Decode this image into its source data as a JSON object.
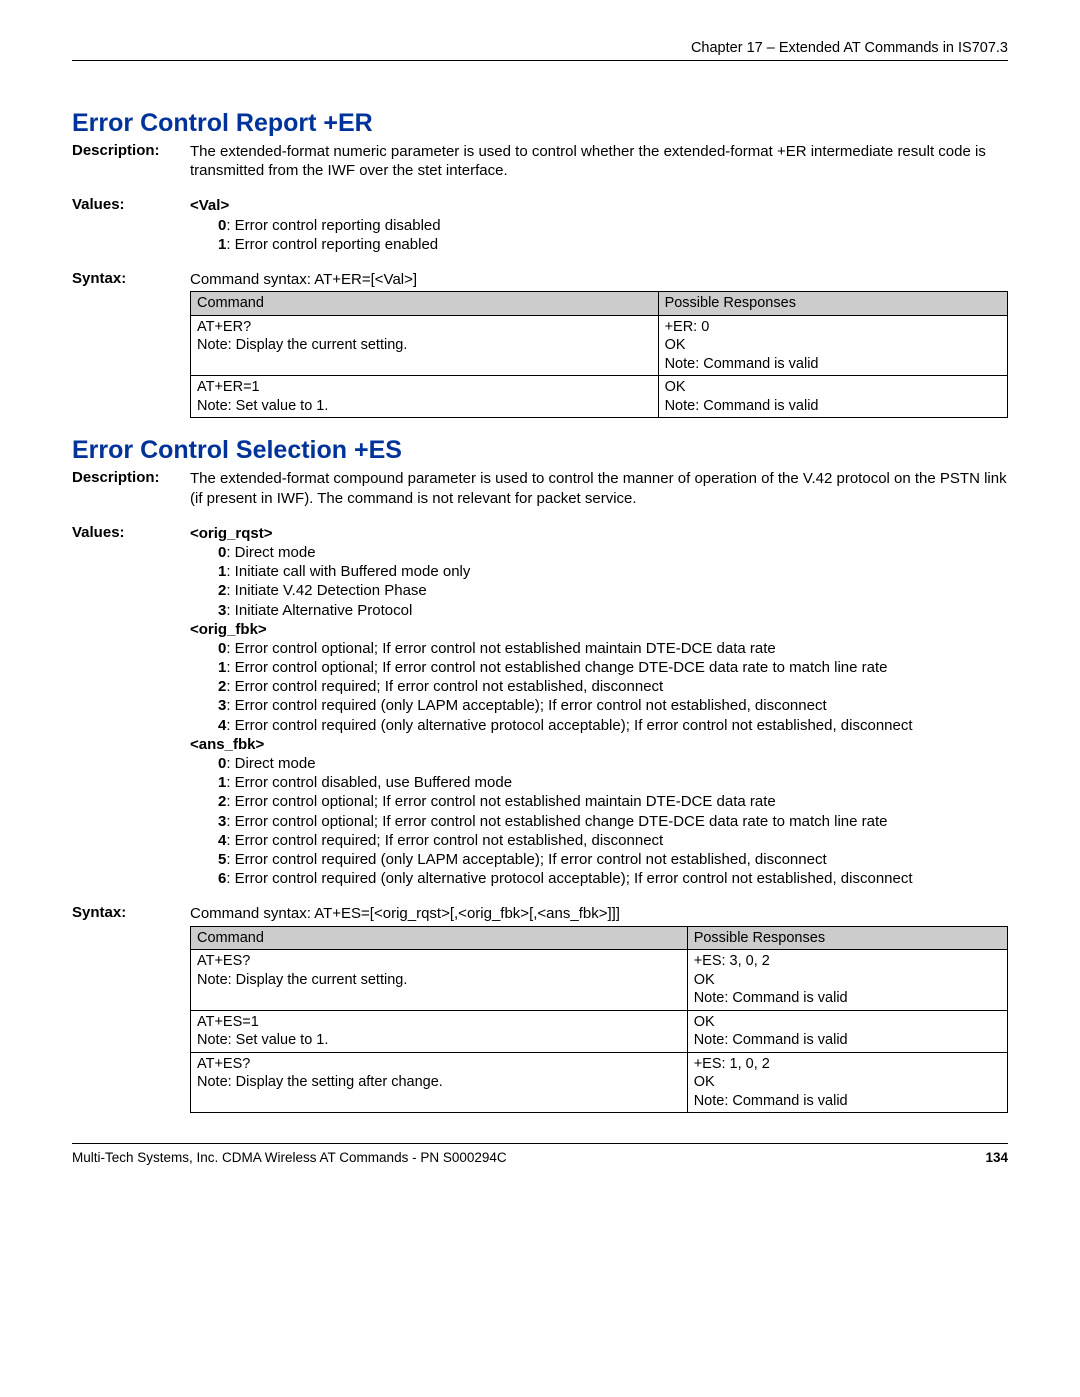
{
  "header": "Chapter 17 – Extended AT Commands in IS707.3",
  "footer_left": "Multi-Tech Systems, Inc. CDMA Wireless AT Commands - PN S000294C",
  "footer_page": "134",
  "s1": {
    "title": "Error Control Report  +ER",
    "desc_label": "Description:",
    "desc": "The extended-format numeric parameter is used to control whether the extended-format +ER intermediate result code is transmitted from the IWF over the stet interface.",
    "values_label": "Values:",
    "val_hdr": "<Val>",
    "val0": ": Error control reporting disabled",
    "val1": ": Error control reporting enabled",
    "syntax_label": "Syntax:",
    "syntax": "Command syntax: AT+ER=[<Val>]",
    "th_cmd": "Command",
    "th_resp": "Possible Responses",
    "r1c": "AT+ER?\nNote: Display the current setting.",
    "r1r": "+ER: 0\nOK\nNote: Command is valid",
    "r2c": "AT+ER=1\nNote: Set value to 1.",
    "r2r": "OK\nNote: Command is valid"
  },
  "s2": {
    "title": "Error Control Selection  +ES",
    "desc_label": "Description:",
    "desc": "The extended-format compound parameter is used to control the manner of operation of the V.42 protocol on the PSTN link (if present in IWF). The command is not relevant for packet service.",
    "values_label": "Values:",
    "orig_rqst_hdr": "<orig_rqst>",
    "or0": ": Direct mode",
    "or1": ": Initiate call with Buffered mode only",
    "or2": ": Initiate V.42 Detection Phase",
    "or3": ": Initiate Alternative Protocol",
    "orig_fbk_hdr": "<orig_fbk>",
    "of0": ": Error control optional; If error control not established maintain DTE-DCE data rate",
    "of1": ": Error control optional; If error control not established change DTE-DCE data rate to match line rate",
    "of2": ": Error control required; If error control not established, disconnect",
    "of3": ": Error control required (only LAPM acceptable); If error control not established, disconnect",
    "of4": ": Error control required (only alternative protocol acceptable); If error control not established, disconnect",
    "ans_fbk_hdr": "<ans_fbk>",
    "af0": ": Direct mode",
    "af1": ": Error control disabled, use Buffered mode",
    "af2": ": Error control optional; If error control not established maintain DTE-DCE data rate",
    "af3": ": Error control optional; If error control not established change DTE-DCE data rate to match line rate",
    "af4": ": Error control required; If error control not established, disconnect",
    "af5": ": Error control required (only LAPM acceptable); If error control not established, disconnect",
    "af6": ": Error control required (only alternative protocol acceptable); If error control not established, disconnect",
    "syntax_label": "Syntax:",
    "syntax": "Command syntax: AT+ES=[<orig_rqst>[,<orig_fbk>[,<ans_fbk>]]]",
    "th_cmd": "Command",
    "th_resp": "Possible Responses",
    "r1c": "AT+ES?\nNote: Display the current setting.",
    "r1r": "+ES: 3, 0, 2\nOK\nNote: Command is valid",
    "r2c": "AT+ES=1\nNote: Set value to 1.",
    "r2r": "OK\nNote: Command is valid",
    "r3c": "AT+ES?\nNote: Display the setting after change.",
    "r3r": "+ES: 1, 0, 2\nOK\nNote: Command is valid"
  }
}
